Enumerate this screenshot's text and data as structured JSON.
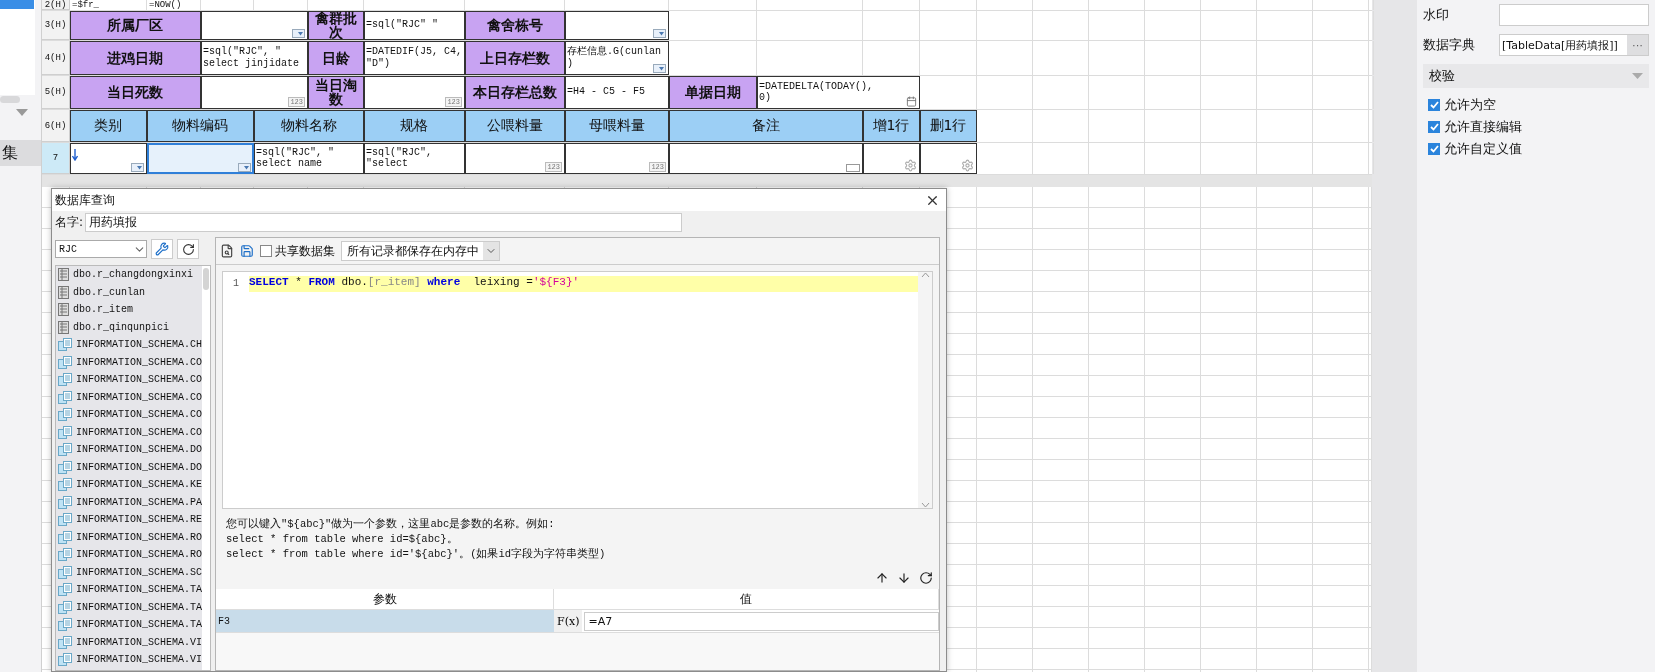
{
  "left_panel": {
    "items": [
      {
        "label": "集",
        "selected": true
      }
    ]
  },
  "row_headers": [
    "2(H)",
    "3(H)",
    "4(H)",
    "5(H)",
    "6(H)",
    "7"
  ],
  "top_cells": [
    "=$fr_",
    "=NOW()"
  ],
  "form": {
    "rows": [
      [
        {
          "label": "所属厂区",
          "widget": {
            "kind": "dropdown"
          }
        },
        {
          "label": "禽群批次",
          "value": "=sql(\"RJC\" \""
        },
        {
          "label": "禽舍栋号",
          "widget": {
            "kind": "dropdown"
          }
        }
      ],
      [
        {
          "label": "进鸡日期",
          "value": "=sql(\"RJC\", \"\nselect jinjidate"
        },
        {
          "label": "日龄",
          "value": "=DATEDIF(J5, C4,\n\"D\")"
        },
        {
          "label": "上日存栏数",
          "value": "存栏信息.G(cunlan\n)",
          "widget": {
            "kind": "dropdown"
          }
        }
      ],
      [
        {
          "label": "当日死数",
          "widget": {
            "kind": "number",
            "label": "123"
          }
        },
        {
          "label": "当日淘数",
          "widget": {
            "kind": "number",
            "label": "123"
          }
        },
        {
          "label": "本日存栏总数",
          "value": "=H4 - C5 - F5"
        },
        {
          "label": "单据日期",
          "value": "=DATEDELTA(TODAY(),\n0)",
          "widget": {
            "kind": "date"
          }
        }
      ]
    ]
  },
  "table": {
    "columns": [
      "类别",
      "物料编码",
      "物料名称",
      "规格",
      "公喂料量",
      "母喂料量",
      "备注",
      "增1行",
      "删1行"
    ],
    "rows": [
      {
        "cells": [
          {
            "expand": true,
            "widget": {
              "kind": "dropdown"
            },
            "selected": false
          },
          {
            "widget": {
              "kind": "dropdown"
            },
            "selected": true
          },
          {
            "value": "=sql(\"RJC\", \"\nselect name",
            "selected": false
          },
          {
            "value": "=sql(\"RJC\",\n\"select",
            "selected": false
          },
          {
            "widget": {
              "kind": "number",
              "label": "123"
            },
            "selected": false
          },
          {
            "widget": {
              "kind": "number",
              "label": "123"
            },
            "selected": false
          },
          {
            "widget": {
              "kind": "text"
            },
            "selected": false
          },
          {
            "widget": {
              "kind": "gear"
            },
            "selected": false
          },
          {
            "widget": {
              "kind": "gear"
            },
            "selected": false
          }
        ]
      }
    ]
  },
  "properties": {
    "fields": [
      {
        "label": "水印"
      },
      {
        "label": "数据字典",
        "value": "[TableData[用药填报]]",
        "button": "···"
      }
    ],
    "section": {
      "title": "校验",
      "expanded": true
    },
    "checks": [
      {
        "label": "允许为空",
        "checked": true
      },
      {
        "label": "允许直接编辑",
        "checked": true
      },
      {
        "label": "允许自定义值",
        "checked": true
      }
    ]
  },
  "dialog": {
    "title": "数据库查询",
    "name_label": "名字:",
    "name_value": "用药填报",
    "connection": "RJC",
    "tables": [
      {
        "name": "dbo.r_changdongxinxi",
        "kind": "table"
      },
      {
        "name": "dbo.r_cunlan",
        "kind": "table"
      },
      {
        "name": "dbo.r_item",
        "kind": "table"
      },
      {
        "name": "dbo.r_qinqunpici",
        "kind": "table"
      },
      {
        "name": "INFORMATION_SCHEMA.CH",
        "kind": "view"
      },
      {
        "name": "INFORMATION_SCHEMA.CO",
        "kind": "view"
      },
      {
        "name": "INFORMATION_SCHEMA.CO",
        "kind": "view"
      },
      {
        "name": "INFORMATION_SCHEMA.CO",
        "kind": "view"
      },
      {
        "name": "INFORMATION_SCHEMA.CO",
        "kind": "view"
      },
      {
        "name": "INFORMATION_SCHEMA.CO",
        "kind": "view"
      },
      {
        "name": "INFORMATION_SCHEMA.DO",
        "kind": "view"
      },
      {
        "name": "INFORMATION_SCHEMA.DO",
        "kind": "view"
      },
      {
        "name": "INFORMATION_SCHEMA.KE",
        "kind": "view"
      },
      {
        "name": "INFORMATION_SCHEMA.PA",
        "kind": "view"
      },
      {
        "name": "INFORMATION_SCHEMA.RE",
        "kind": "view"
      },
      {
        "name": "INFORMATION_SCHEMA.RO",
        "kind": "view"
      },
      {
        "name": "INFORMATION_SCHEMA.RO",
        "kind": "view"
      },
      {
        "name": "INFORMATION_SCHEMA.SC",
        "kind": "view"
      },
      {
        "name": "INFORMATION_SCHEMA.TA",
        "kind": "view"
      },
      {
        "name": "INFORMATION_SCHEMA.TA",
        "kind": "view"
      },
      {
        "name": "INFORMATION_SCHEMA.TA",
        "kind": "view"
      },
      {
        "name": "INFORMATION_SCHEMA.VI",
        "kind": "view"
      },
      {
        "name": "INFORMATION_SCHEMA.VI",
        "kind": "view"
      }
    ],
    "share": {
      "label": "共享数据集",
      "checked": false
    },
    "storage": "所有记录都保存在内存中",
    "editor": {
      "line_number": "1",
      "tokens": [
        {
          "text": "SELECT",
          "kind": "keyword"
        },
        {
          "text": " * ",
          "kind": "plain"
        },
        {
          "text": "FROM",
          "kind": "keyword"
        },
        {
          "text": " dbo.",
          "kind": "plain"
        },
        {
          "text": "[r_item]",
          "kind": "bracket"
        },
        {
          "text": " where",
          "kind": "keyword"
        },
        {
          "text": "  leixing =",
          "kind": "plain"
        },
        {
          "text": "'${F3}'",
          "kind": "string"
        }
      ]
    },
    "hint": [
      "您可以键入\"${abc}\"做为一个参数，这里abc是参数的名称。例如:",
      "select * from table where id=${abc}。",
      "select * from table where id='${abc}'。(如果id字段为字符串类型)"
    ],
    "params": {
      "columns": [
        "参数",
        "值"
      ],
      "formula_button": "F(x)",
      "rows": [
        {
          "name": "F3",
          "value": "=A7",
          "selected": true
        }
      ]
    }
  }
}
